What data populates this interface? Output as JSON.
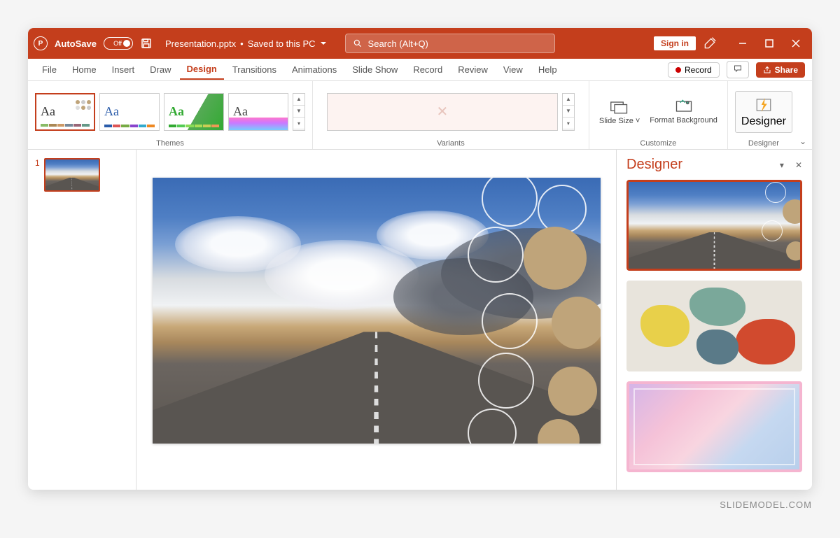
{
  "titlebar": {
    "autosave_label": "AutoSave",
    "autosave_state": "Off",
    "filename": "Presentation.pptx",
    "save_status": "Saved to this PC",
    "search_placeholder": "Search (Alt+Q)",
    "signin_label": "Sign in"
  },
  "tabs": {
    "items": [
      "File",
      "Home",
      "Insert",
      "Draw",
      "Design",
      "Transitions",
      "Animations",
      "Slide Show",
      "Record",
      "Review",
      "View",
      "Help"
    ],
    "active": "Design",
    "record_label": "Record",
    "share_label": "Share"
  },
  "ribbon": {
    "themes_label": "Themes",
    "variants_label": "Variants",
    "customize_label": "Customize",
    "slide_size_label": "Slide Size",
    "format_bg_label": "Format Background",
    "designer_group_label": "Designer",
    "designer_btn_label": "Designer"
  },
  "thumbnails": {
    "slide1_num": "1"
  },
  "designer_panel": {
    "title": "Designer"
  },
  "watermark": "SLIDEMODEL.COM"
}
